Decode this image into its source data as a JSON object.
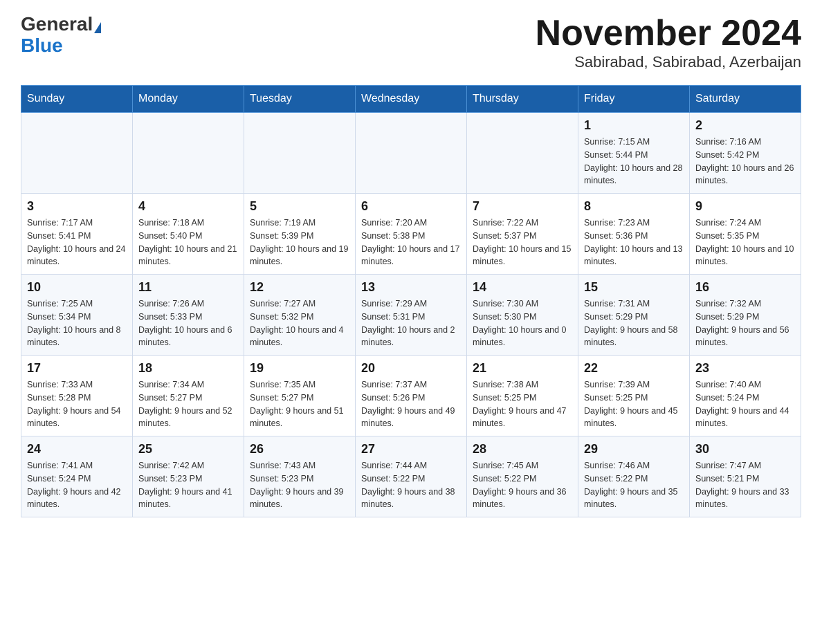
{
  "logo": {
    "general": "General",
    "blue": "Blue"
  },
  "title": "November 2024",
  "subtitle": "Sabirabad, Sabirabad, Azerbaijan",
  "weekdays": [
    "Sunday",
    "Monday",
    "Tuesday",
    "Wednesday",
    "Thursday",
    "Friday",
    "Saturday"
  ],
  "weeks": [
    [
      {
        "day": "",
        "sunrise": "",
        "sunset": "",
        "daylight": ""
      },
      {
        "day": "",
        "sunrise": "",
        "sunset": "",
        "daylight": ""
      },
      {
        "day": "",
        "sunrise": "",
        "sunset": "",
        "daylight": ""
      },
      {
        "day": "",
        "sunrise": "",
        "sunset": "",
        "daylight": ""
      },
      {
        "day": "",
        "sunrise": "",
        "sunset": "",
        "daylight": ""
      },
      {
        "day": "1",
        "sunrise": "Sunrise: 7:15 AM",
        "sunset": "Sunset: 5:44 PM",
        "daylight": "Daylight: 10 hours and 28 minutes."
      },
      {
        "day": "2",
        "sunrise": "Sunrise: 7:16 AM",
        "sunset": "Sunset: 5:42 PM",
        "daylight": "Daylight: 10 hours and 26 minutes."
      }
    ],
    [
      {
        "day": "3",
        "sunrise": "Sunrise: 7:17 AM",
        "sunset": "Sunset: 5:41 PM",
        "daylight": "Daylight: 10 hours and 24 minutes."
      },
      {
        "day": "4",
        "sunrise": "Sunrise: 7:18 AM",
        "sunset": "Sunset: 5:40 PM",
        "daylight": "Daylight: 10 hours and 21 minutes."
      },
      {
        "day": "5",
        "sunrise": "Sunrise: 7:19 AM",
        "sunset": "Sunset: 5:39 PM",
        "daylight": "Daylight: 10 hours and 19 minutes."
      },
      {
        "day": "6",
        "sunrise": "Sunrise: 7:20 AM",
        "sunset": "Sunset: 5:38 PM",
        "daylight": "Daylight: 10 hours and 17 minutes."
      },
      {
        "day": "7",
        "sunrise": "Sunrise: 7:22 AM",
        "sunset": "Sunset: 5:37 PM",
        "daylight": "Daylight: 10 hours and 15 minutes."
      },
      {
        "day": "8",
        "sunrise": "Sunrise: 7:23 AM",
        "sunset": "Sunset: 5:36 PM",
        "daylight": "Daylight: 10 hours and 13 minutes."
      },
      {
        "day": "9",
        "sunrise": "Sunrise: 7:24 AM",
        "sunset": "Sunset: 5:35 PM",
        "daylight": "Daylight: 10 hours and 10 minutes."
      }
    ],
    [
      {
        "day": "10",
        "sunrise": "Sunrise: 7:25 AM",
        "sunset": "Sunset: 5:34 PM",
        "daylight": "Daylight: 10 hours and 8 minutes."
      },
      {
        "day": "11",
        "sunrise": "Sunrise: 7:26 AM",
        "sunset": "Sunset: 5:33 PM",
        "daylight": "Daylight: 10 hours and 6 minutes."
      },
      {
        "day": "12",
        "sunrise": "Sunrise: 7:27 AM",
        "sunset": "Sunset: 5:32 PM",
        "daylight": "Daylight: 10 hours and 4 minutes."
      },
      {
        "day": "13",
        "sunrise": "Sunrise: 7:29 AM",
        "sunset": "Sunset: 5:31 PM",
        "daylight": "Daylight: 10 hours and 2 minutes."
      },
      {
        "day": "14",
        "sunrise": "Sunrise: 7:30 AM",
        "sunset": "Sunset: 5:30 PM",
        "daylight": "Daylight: 10 hours and 0 minutes."
      },
      {
        "day": "15",
        "sunrise": "Sunrise: 7:31 AM",
        "sunset": "Sunset: 5:29 PM",
        "daylight": "Daylight: 9 hours and 58 minutes."
      },
      {
        "day": "16",
        "sunrise": "Sunrise: 7:32 AM",
        "sunset": "Sunset: 5:29 PM",
        "daylight": "Daylight: 9 hours and 56 minutes."
      }
    ],
    [
      {
        "day": "17",
        "sunrise": "Sunrise: 7:33 AM",
        "sunset": "Sunset: 5:28 PM",
        "daylight": "Daylight: 9 hours and 54 minutes."
      },
      {
        "day": "18",
        "sunrise": "Sunrise: 7:34 AM",
        "sunset": "Sunset: 5:27 PM",
        "daylight": "Daylight: 9 hours and 52 minutes."
      },
      {
        "day": "19",
        "sunrise": "Sunrise: 7:35 AM",
        "sunset": "Sunset: 5:27 PM",
        "daylight": "Daylight: 9 hours and 51 minutes."
      },
      {
        "day": "20",
        "sunrise": "Sunrise: 7:37 AM",
        "sunset": "Sunset: 5:26 PM",
        "daylight": "Daylight: 9 hours and 49 minutes."
      },
      {
        "day": "21",
        "sunrise": "Sunrise: 7:38 AM",
        "sunset": "Sunset: 5:25 PM",
        "daylight": "Daylight: 9 hours and 47 minutes."
      },
      {
        "day": "22",
        "sunrise": "Sunrise: 7:39 AM",
        "sunset": "Sunset: 5:25 PM",
        "daylight": "Daylight: 9 hours and 45 minutes."
      },
      {
        "day": "23",
        "sunrise": "Sunrise: 7:40 AM",
        "sunset": "Sunset: 5:24 PM",
        "daylight": "Daylight: 9 hours and 44 minutes."
      }
    ],
    [
      {
        "day": "24",
        "sunrise": "Sunrise: 7:41 AM",
        "sunset": "Sunset: 5:24 PM",
        "daylight": "Daylight: 9 hours and 42 minutes."
      },
      {
        "day": "25",
        "sunrise": "Sunrise: 7:42 AM",
        "sunset": "Sunset: 5:23 PM",
        "daylight": "Daylight: 9 hours and 41 minutes."
      },
      {
        "day": "26",
        "sunrise": "Sunrise: 7:43 AM",
        "sunset": "Sunset: 5:23 PM",
        "daylight": "Daylight: 9 hours and 39 minutes."
      },
      {
        "day": "27",
        "sunrise": "Sunrise: 7:44 AM",
        "sunset": "Sunset: 5:22 PM",
        "daylight": "Daylight: 9 hours and 38 minutes."
      },
      {
        "day": "28",
        "sunrise": "Sunrise: 7:45 AM",
        "sunset": "Sunset: 5:22 PM",
        "daylight": "Daylight: 9 hours and 36 minutes."
      },
      {
        "day": "29",
        "sunrise": "Sunrise: 7:46 AM",
        "sunset": "Sunset: 5:22 PM",
        "daylight": "Daylight: 9 hours and 35 minutes."
      },
      {
        "day": "30",
        "sunrise": "Sunrise: 7:47 AM",
        "sunset": "Sunset: 5:21 PM",
        "daylight": "Daylight: 9 hours and 33 minutes."
      }
    ]
  ]
}
